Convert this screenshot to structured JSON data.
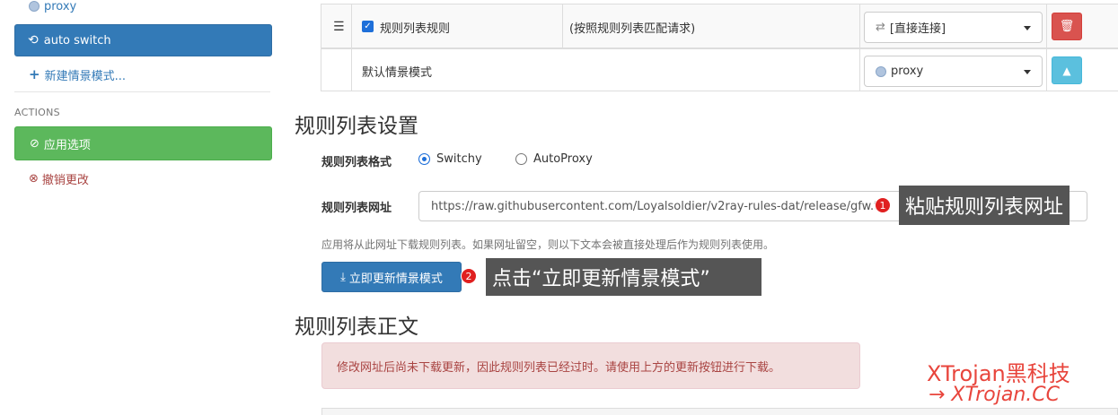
{
  "sidebar": {
    "proxy_label": "proxy",
    "auto_switch_label": "auto switch",
    "new_profile_label": "新建情景模式...",
    "actions_header": "ACTIONS",
    "apply_label": "应用选项",
    "discard_label": "撤销更改"
  },
  "rules_table": {
    "row1": {
      "condition_type": "规则列表规则",
      "checked": true,
      "condition_detail": "(按照规则列表匹配请求)",
      "profile": "[直接连接]"
    },
    "row2": {
      "condition_type": "默认情景模式",
      "profile": "proxy"
    }
  },
  "rule_list_settings": {
    "heading": "规则列表设置",
    "format_label": "规则列表格式",
    "format_options": [
      "Switchy",
      "AutoProxy"
    ],
    "format_selected": "Switchy",
    "url_label": "规则列表网址",
    "url_value": "https://raw.githubusercontent.com/Loyalsoldier/v2ray-rules-dat/release/gfw.txt",
    "help_text": "应用将从此网址下载规则列表。如果网址留空，则以下文本会被直接处理后作为规则列表使用。",
    "update_button": "立即更新情景模式"
  },
  "annotations": {
    "step1_number": "1",
    "step1_text": "粘贴规则列表网址",
    "step2_number": "2",
    "step2_text": "点击“立即更新情景模式”"
  },
  "rule_list_text": {
    "heading": "规则列表正文",
    "alert": "修改网址后尚未下载更新，因此规则列表已经过时。请使用上方的更新按钮进行下载。"
  },
  "watermark": {
    "line1": "XTrojan黑科技",
    "line2": "→ XTrojan.CC"
  },
  "colors": {
    "primary": "#337ab7",
    "success": "#5cb85c",
    "danger": "#d9534f",
    "info": "#5bc0de",
    "watermark": "#e8453c"
  }
}
